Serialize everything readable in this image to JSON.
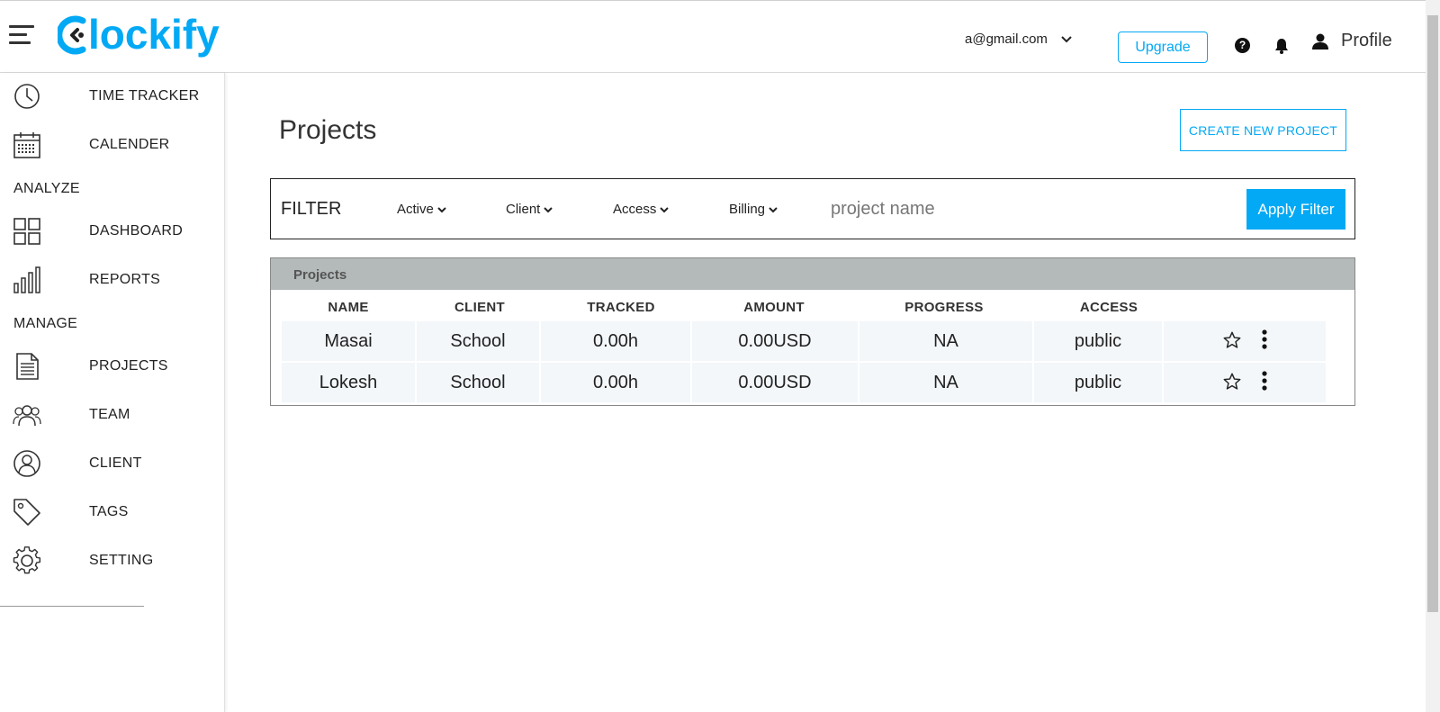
{
  "header": {
    "logo": "Clockify",
    "account_email": "a@gmail.com",
    "upgrade_label": "Upgrade",
    "profile_label": "Profile"
  },
  "sidebar": {
    "items": [
      {
        "label": "TIME TRACKER",
        "icon": "clock-icon"
      },
      {
        "label": "CALENDER",
        "icon": "calendar-icon"
      },
      {
        "label": "DASHBOARD",
        "icon": "dashboard-icon"
      },
      {
        "label": "REPORTS",
        "icon": "reports-icon"
      },
      {
        "label": "PROJECTS",
        "icon": "document-icon"
      },
      {
        "label": "TEAM",
        "icon": "team-icon"
      },
      {
        "label": "CLIENT",
        "icon": "user-circle-icon"
      },
      {
        "label": "TAGS",
        "icon": "tag-icon"
      },
      {
        "label": "SETTING",
        "icon": "gear-icon"
      }
    ],
    "sections": {
      "analyze": "ANALYZE",
      "manage": "MANAGE"
    }
  },
  "main": {
    "title": "Projects",
    "create_button": "CREATE NEW PROJECT"
  },
  "filter": {
    "label": "FILTER",
    "dropdowns": [
      "Active",
      "Client",
      "Access",
      "Billing"
    ],
    "search_placeholder": "project name",
    "search_value": "",
    "apply_label": "Apply Filter"
  },
  "table": {
    "title": "Projects",
    "columns": [
      "NAME",
      "CLIENT",
      "TRACKED",
      "AMOUNT",
      "PROGRESS",
      "ACCESS"
    ],
    "rows": [
      {
        "name": "Masai",
        "client": "School",
        "tracked": "0.00h",
        "amount": "0.00USD",
        "progress": "NA",
        "access": "public"
      },
      {
        "name": "Lokesh",
        "client": "School",
        "tracked": "0.00h",
        "amount": "0.00USD",
        "progress": "NA",
        "access": "public"
      }
    ]
  },
  "colors": {
    "brand": "#03a9f4",
    "table_header_bar": "#b4b9b9",
    "row_bg": "#f3f7fa"
  }
}
